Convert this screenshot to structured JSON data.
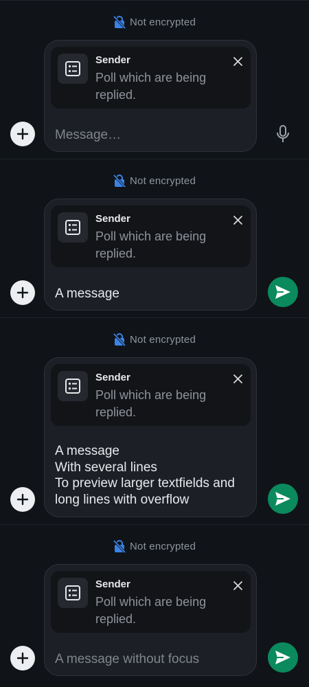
{
  "encryption_text": "Not encrypted",
  "reply": {
    "sender": "Sender",
    "text": "Poll which are being replied."
  },
  "composers": [
    {
      "text": "Message…",
      "is_placeholder": true,
      "action": "mic-icon"
    },
    {
      "text": "A message",
      "is_placeholder": false,
      "action": "send-icon"
    },
    {
      "text": "A message\nWith several lines\nTo preview larger textfields and\nlong lines with overflow",
      "is_placeholder": false,
      "action": "send-icon"
    },
    {
      "text": "A message without focus",
      "is_placeholder": true,
      "action": "send-icon"
    }
  ],
  "icons": {
    "lock": "lock-off-icon",
    "poll": "poll-icon",
    "close": "close-icon",
    "add": "plus-icon",
    "mic": "mic-icon",
    "send": "send-icon"
  },
  "colors": {
    "background": "#101418",
    "composer_bg": "#1c1f25",
    "reply_bg": "#121418",
    "send_button": "#0b8a5d",
    "lock_icon": "#3b82e6",
    "muted_text": "#8f949b"
  }
}
